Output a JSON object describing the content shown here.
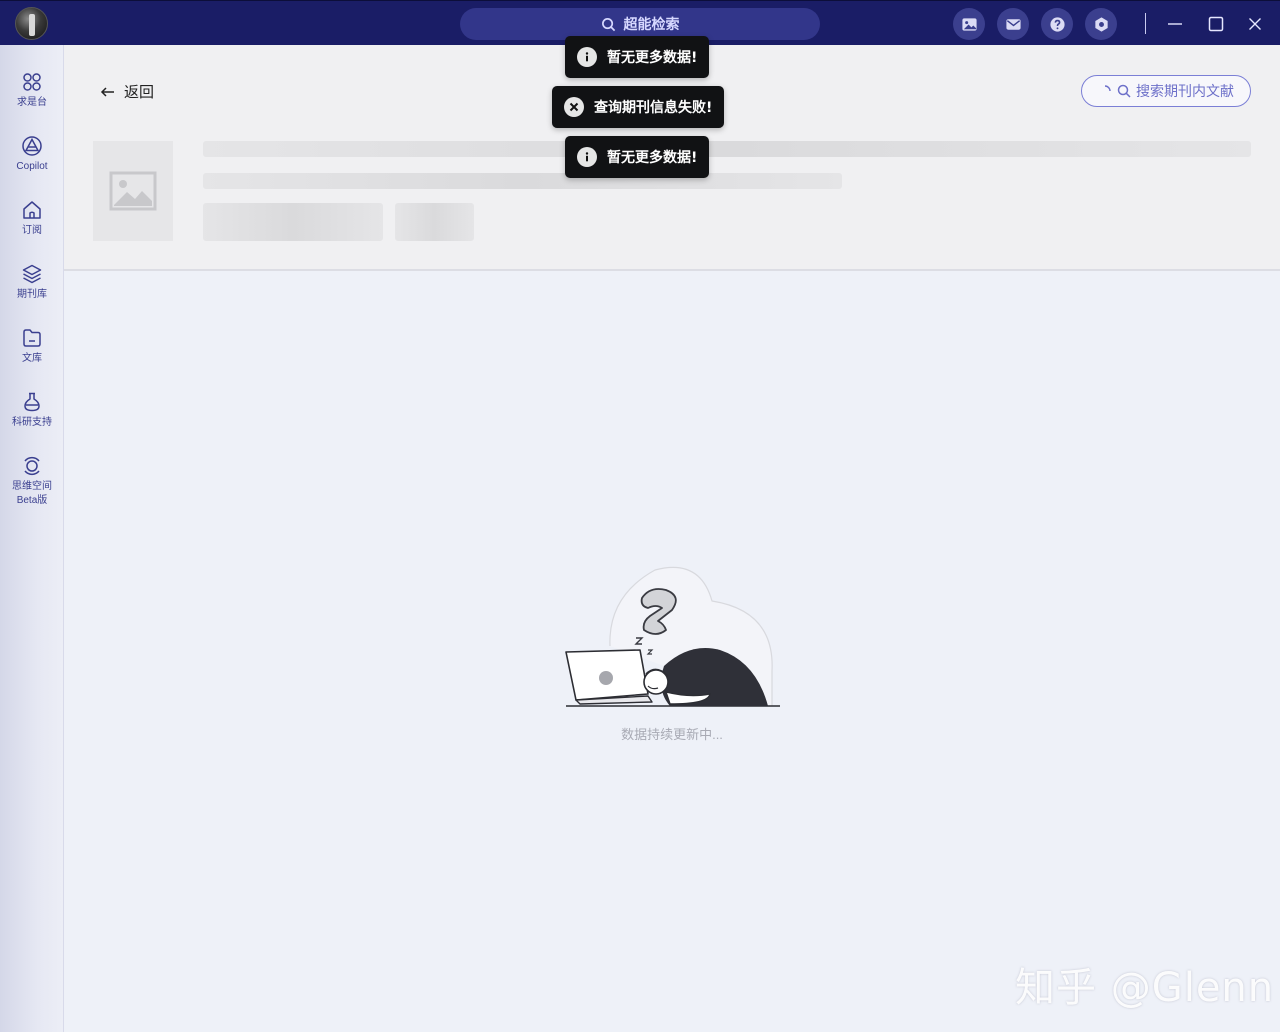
{
  "titlebar": {
    "search_label": "超能检索",
    "icons": [
      "image-icon",
      "mail-icon",
      "help-icon",
      "settings-icon"
    ],
    "window_controls": [
      "minimize-icon",
      "maximize-icon",
      "close-icon"
    ]
  },
  "sidebar": {
    "items": [
      {
        "label": "求是台",
        "icon": "grid-icon"
      },
      {
        "label": "Copilot",
        "icon": "triangle-logo-icon"
      },
      {
        "label": "订阅",
        "icon": "home-icon"
      },
      {
        "label": "期刊库",
        "icon": "layers-icon"
      },
      {
        "label": "文库",
        "icon": "folder-icon"
      },
      {
        "label": "科研支持",
        "icon": "flask-icon"
      },
      {
        "label": "思维空间",
        "sublabel": "Beta版",
        "icon": "orbit-icon"
      }
    ]
  },
  "header": {
    "back_label": "返回",
    "search_journal_label": "搜索期刊内文献"
  },
  "toasts": [
    {
      "type": "info",
      "text": "暂无更多数据!"
    },
    {
      "type": "error",
      "text": "查询期刊信息失败!"
    },
    {
      "type": "info",
      "text": "暂无更多数据!"
    }
  ],
  "empty_state": {
    "text": "数据持续更新中..."
  },
  "watermark": "知乎 @Glenn",
  "colors": {
    "titlebar": "#1a1d66",
    "accent": "#3a3f8f",
    "toast_bg": "#111214"
  }
}
